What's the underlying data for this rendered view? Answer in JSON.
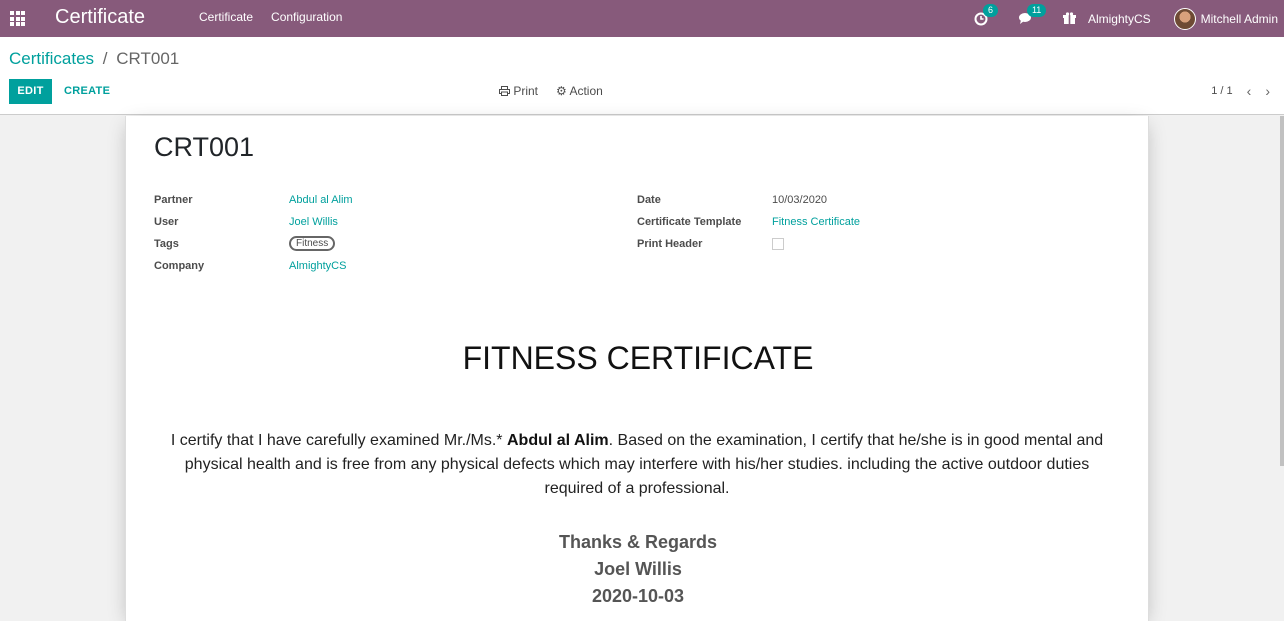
{
  "navbar": {
    "app_title": "Certificate",
    "menu": [
      "Certificate",
      "Configuration"
    ],
    "activity_count": "6",
    "messages_count": "11",
    "company": "AlmightyCS",
    "user": "Mitchell Admin"
  },
  "control_panel": {
    "breadcrumb_parent": "Certificates",
    "breadcrumb_sep": "/",
    "breadcrumb_current": "CRT001",
    "edit_label": "EDIT",
    "create_label": "CREATE",
    "print_label": "Print",
    "action_label": "Action",
    "pager": "1 / 1"
  },
  "record": {
    "name": "CRT001",
    "fields_left": {
      "partner_label": "Partner",
      "partner_value": "Abdul al Alim",
      "user_label": "User",
      "user_value": "Joel Willis",
      "tags_label": "Tags",
      "tags_value": "Fitness",
      "company_label": "Company",
      "company_value": "AlmightyCS"
    },
    "fields_right": {
      "date_label": "Date",
      "date_value": "10/03/2020",
      "template_label": "Certificate Template",
      "template_value": "Fitness Certificate",
      "print_header_label": "Print Header",
      "print_header_checked": false
    }
  },
  "certificate": {
    "heading": "FITNESS CERTIFICATE",
    "body_prefix": "I certify that I have carefully examined Mr./Ms.*",
    "body_name": "Abdul al Alim",
    "body_suffix": ". Based on the examination, I certify that he/she is in good mental and physical health and is free from any physical defects which may interfere with his/her studies. including the active outdoor duties required of a professional.",
    "regards": "Thanks & Regards",
    "signer": "Joel Willis",
    "sign_date": "2020-10-03"
  },
  "colors": {
    "navbar": "#875a7b",
    "accent": "#00a09d"
  }
}
